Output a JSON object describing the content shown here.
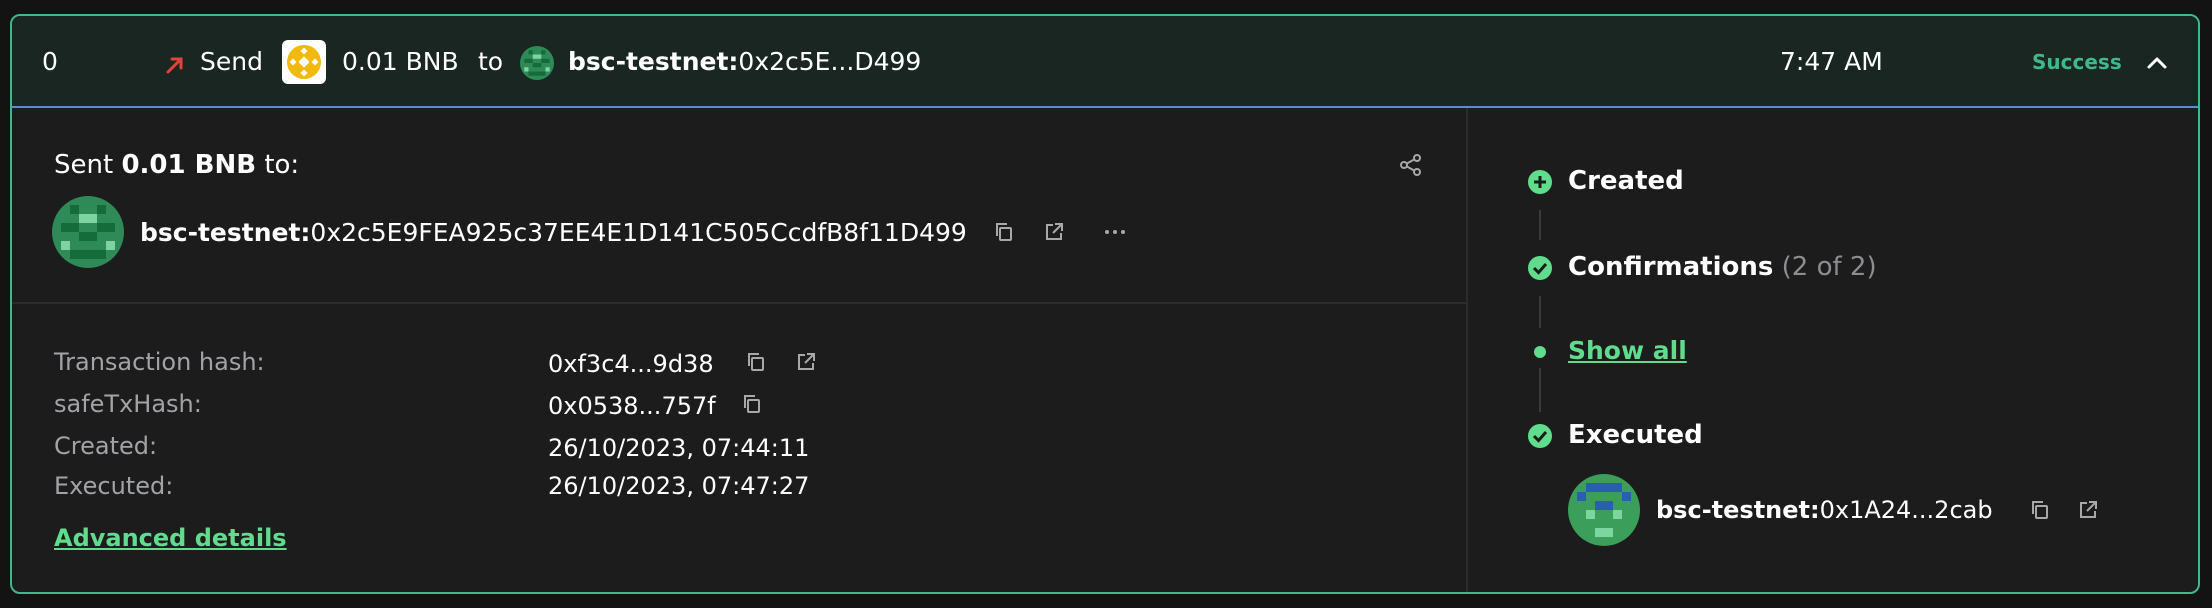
{
  "summary": {
    "nonce": "0",
    "direction": "Send",
    "amount": "0.01 BNB",
    "to_word": "to",
    "chain": "bsc-testnet:",
    "address_short": "0x2c5E...D499",
    "time": "7:47 AM",
    "status": "Success"
  },
  "details": {
    "sent_prefix": "Sent",
    "sent_amount": "0.01 BNB",
    "sent_suffix": "to:",
    "recipient_chain": "bsc-testnet:",
    "recipient_address": "0x2c5E9FEA925c37EE4E1D141C505CcdfB8f11D499",
    "rows": [
      {
        "label": "Transaction hash:",
        "value": "0xf3c4...9d38"
      },
      {
        "label": "safeTxHash:",
        "value": "0x0538...757f"
      },
      {
        "label": "Created:",
        "value": "26/10/2023, 07:44:11"
      },
      {
        "label": "Executed:",
        "value": "26/10/2023, 07:47:27"
      }
    ],
    "advanced_link": "Advanced details"
  },
  "timeline": {
    "created": "Created",
    "confirmations": "Confirmations",
    "confirmations_count": "(2 of 2)",
    "show_all": "Show all",
    "executed": "Executed",
    "executor_chain": "bsc-testnet:",
    "executor_address": "0x1A24...2cab"
  },
  "colors": {
    "success": "#3fb98b",
    "link": "#5fdd8c",
    "outgoing_arrow": "#e0443a"
  },
  "icons": [
    "outgoing-arrow-icon",
    "bnb-token-icon",
    "identicon",
    "chevron-up-icon",
    "share-icon",
    "copy-icon",
    "external-link-icon",
    "more-icon",
    "plus-circle-icon",
    "check-circle-icon",
    "dot-icon"
  ]
}
